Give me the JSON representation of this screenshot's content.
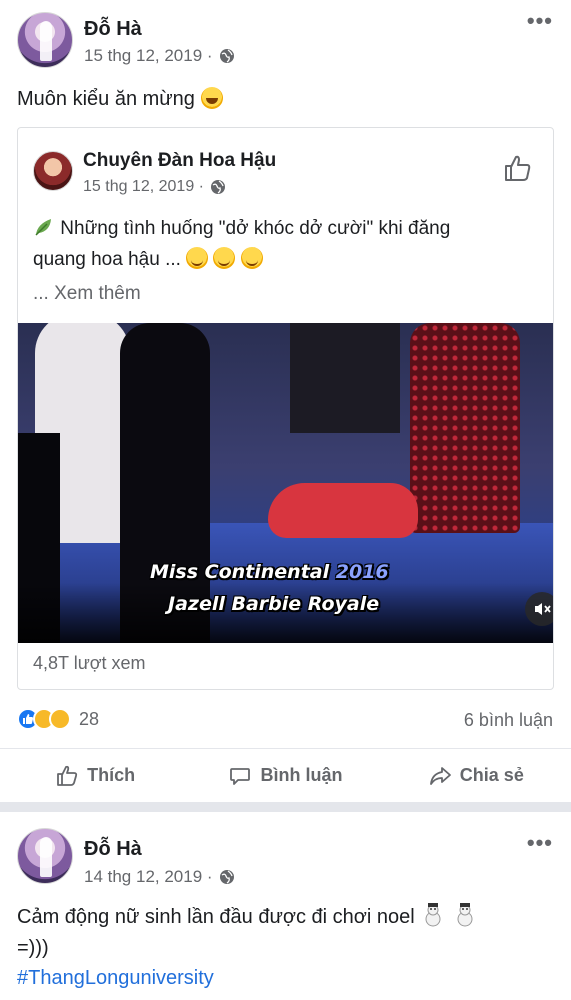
{
  "post1": {
    "author": "Đỗ Hà",
    "date": "15 thg 12, 2019 ·",
    "text": "Muôn kiểu ăn mừng",
    "shared": {
      "author": "Chuyên Đàn Hoa Hậu",
      "date": "15 thg 12, 2019 ·",
      "text_line1": "Những tình huống \"dở khóc dở cười\" khi đăng",
      "text_line2": "quang hoa hậu ...",
      "see_more": "... Xem thêm",
      "video_caption_line1_a": "Miss Continental ",
      "video_caption_line1_b": "2016",
      "video_caption_line2": "Jazell Barbie Royale",
      "views": "4,8T lượt xem"
    },
    "reaction_count": "28",
    "comments": "6 bình luận",
    "actions": {
      "like": "Thích",
      "comment": "Bình luận",
      "share": "Chia sẻ"
    }
  },
  "post2": {
    "author": "Đỗ Hà",
    "date": "14 thg 12, 2019 ·",
    "text_line1": "Cảm động nữ sinh lần đầu được đi chơi noel",
    "text_line2": "=)))",
    "hashtag": "#ThangLonguniversity"
  },
  "colors": {
    "link": "#216fdb",
    "meta": "#65676b",
    "separator": "#e4e6eb",
    "like_blue": "#1877f2"
  },
  "icons": [
    "globe-icon",
    "more-icon",
    "thumbs-up-icon",
    "comment-icon",
    "share-icon",
    "mute-icon",
    "leaf-icon",
    "laughing-emoji",
    "smile-emoji",
    "snowman-emoji"
  ]
}
